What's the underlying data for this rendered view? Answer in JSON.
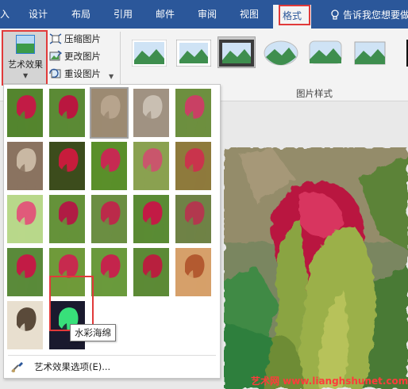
{
  "ribbon_tabs": {
    "cut_tab": "入",
    "design": "设计",
    "layout": "布局",
    "references": "引用",
    "mailings": "邮件",
    "review": "审阅",
    "view": "视图",
    "format": "格式"
  },
  "tell_me": "告诉我您想要做",
  "ribbon": {
    "artistic_effects": "艺术效果",
    "compress": "压缩图片",
    "change": "更改图片",
    "reset": "重设图片",
    "picture_styles_group": "图片样式"
  },
  "gallery": {
    "tooltip": "水彩海绵",
    "options": "艺术效果选项(E)...",
    "effects": [
      {
        "effect": "none",
        "base": "#54852e",
        "tint": "#c21b45"
      },
      {
        "effect": "pencil-grayscale",
        "base": "#5b8a35",
        "tint": "#b9173f"
      },
      {
        "effect": "pencil-sketch",
        "base": "#9c8a72",
        "tint": "#b7a48d"
      },
      {
        "effect": "line-drawing",
        "base": "#a09282",
        "tint": "#c9bfb2"
      },
      {
        "effect": "chalk-sketch",
        "base": "#6d8f3f",
        "tint": "#c94064"
      },
      {
        "effect": "paint-strokes",
        "base": "#8a7360",
        "tint": "#c9b8a3"
      },
      {
        "effect": "paint-brush",
        "base": "#3c4c1c",
        "tint": "#c71c3c"
      },
      {
        "effect": "glow-diffused",
        "base": "#5a8f2a",
        "tint": "#c62a52"
      },
      {
        "effect": "blur",
        "base": "#8aa150",
        "tint": "#c9566c"
      },
      {
        "effect": "light-screen",
        "base": "#8e7a3c",
        "tint": "#c9344c"
      },
      {
        "effect": "mosaic-bubbles",
        "base": "#b8d88a",
        "tint": "#e05a7a"
      },
      {
        "effect": "watercolor-sponge",
        "base": "#65923a",
        "tint": "#b01c44"
      },
      {
        "effect": "film-grain",
        "base": "#6b8e42",
        "tint": "#bb2a4a"
      },
      {
        "effect": "glass",
        "base": "#5a8b34",
        "tint": "#c21b45"
      },
      {
        "effect": "cement",
        "base": "#6f8246",
        "tint": "#b2384e"
      },
      {
        "effect": "texturizer",
        "base": "#5a8a3a",
        "tint": "#c21b45"
      },
      {
        "effect": "crisscross-etching",
        "base": "#6f9a3a",
        "tint": "#c72a4e"
      },
      {
        "effect": "pastels-smooth",
        "base": "#6a9a3c",
        "tint": "#c4244c"
      },
      {
        "effect": "plastic-wrap",
        "base": "#5c8a36",
        "tint": "#b8203e"
      },
      {
        "effect": "cutout",
        "base": "#d6a06a",
        "tint": "#b35a30"
      },
      {
        "effect": "photocopy",
        "base": "#e8dfcf",
        "tint": "#5a4a3a"
      },
      {
        "effect": "glow-edges",
        "base": "#1a1a2e",
        "tint": "#38e07a"
      }
    ]
  },
  "watermark": "艺术网 www.lianghshunet.com",
  "colors": {
    "ribbon_blue": "#2b579a",
    "highlight_red": "#e13a3a",
    "rose_red": "#c21b45",
    "leaf_green": "#5b8a35"
  }
}
